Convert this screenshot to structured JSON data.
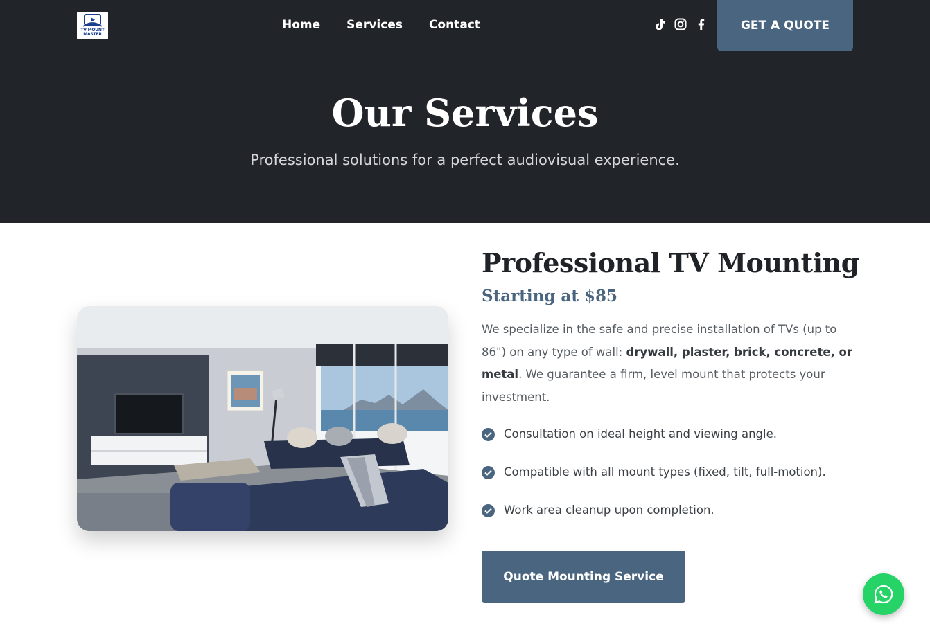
{
  "header": {
    "logo_text": "TV MOUNT MASTER",
    "nav": [
      {
        "label": "Home"
      },
      {
        "label": "Services"
      },
      {
        "label": "Contact"
      }
    ],
    "social_icons": [
      "tiktok-icon",
      "instagram-icon",
      "facebook-icon"
    ],
    "cta_label": "GET A QUOTE"
  },
  "hero": {
    "title": "Our Services",
    "subtitle": "Professional solutions for a perfect audiovisual experience."
  },
  "service": {
    "title": "Professional TV Mounting",
    "price": "Starting at $85",
    "description": {
      "intro": "We specialize in the safe and precise installation of TVs (up to 86\") on any type of wall: ",
      "materials": "drywall, plaster, brick, concrete, or metal",
      "outro": ". We guarantee a firm, level mount that protects your investment."
    },
    "features": [
      "Consultation on ideal height and viewing angle.",
      "Compatible with all mount types (fixed, tilt, full-motion).",
      "Work area cleanup upon completion."
    ],
    "button_label": "Quote Mounting Service"
  },
  "floating": {
    "icon": "whatsapp-icon"
  },
  "colors": {
    "hero_bg": "#212429",
    "accent": "#49657f",
    "whatsapp": "#25d366"
  }
}
